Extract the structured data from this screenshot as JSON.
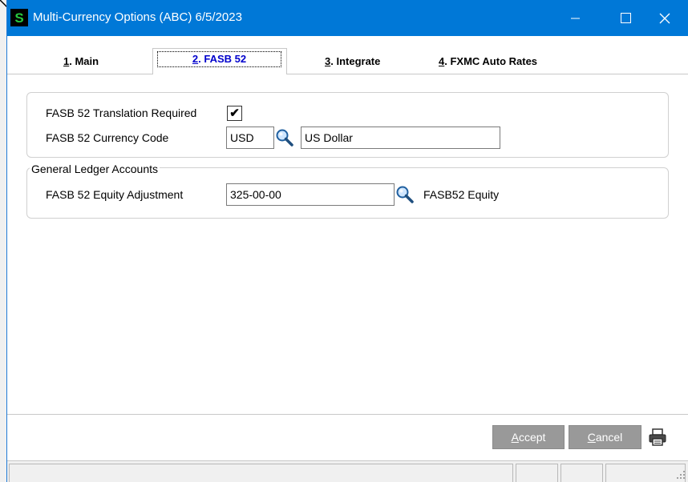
{
  "window": {
    "title": "Multi-Currency Options  (ABC) 6/5/2023",
    "icon": "sage-app-icon",
    "controls": [
      "minimize-icon",
      "maximize-icon",
      "close-icon"
    ]
  },
  "tabs": [
    {
      "num": "1",
      "label": ". Main",
      "selected": false
    },
    {
      "num": "2",
      "label": ". FASB 52",
      "selected": true
    },
    {
      "num": "3",
      "label": ". Integrate",
      "selected": false
    },
    {
      "num": "4",
      "label": ". FXMC Auto Rates",
      "selected": false
    }
  ],
  "fasb": {
    "translation_label": "FASB 52 Translation Required",
    "translation_checked": "✔",
    "currency_label": "FASB 52 Currency Code",
    "currency_code": "USD",
    "currency_desc": "US Dollar"
  },
  "gl": {
    "legend": "General Ledger Accounts",
    "equity_label": "FASB 52 Equity Adjustment",
    "equity_account": "325-00-00",
    "equity_desc": "FASB52 Equity"
  },
  "buttons": {
    "accept_key": "A",
    "accept_rest": "ccept",
    "cancel_key": "C",
    "cancel_rest": "ancel"
  },
  "colors": {
    "titlebar": "#0078d7",
    "selected_tab_text": "#0000cc",
    "button_disabled": "#999999"
  }
}
